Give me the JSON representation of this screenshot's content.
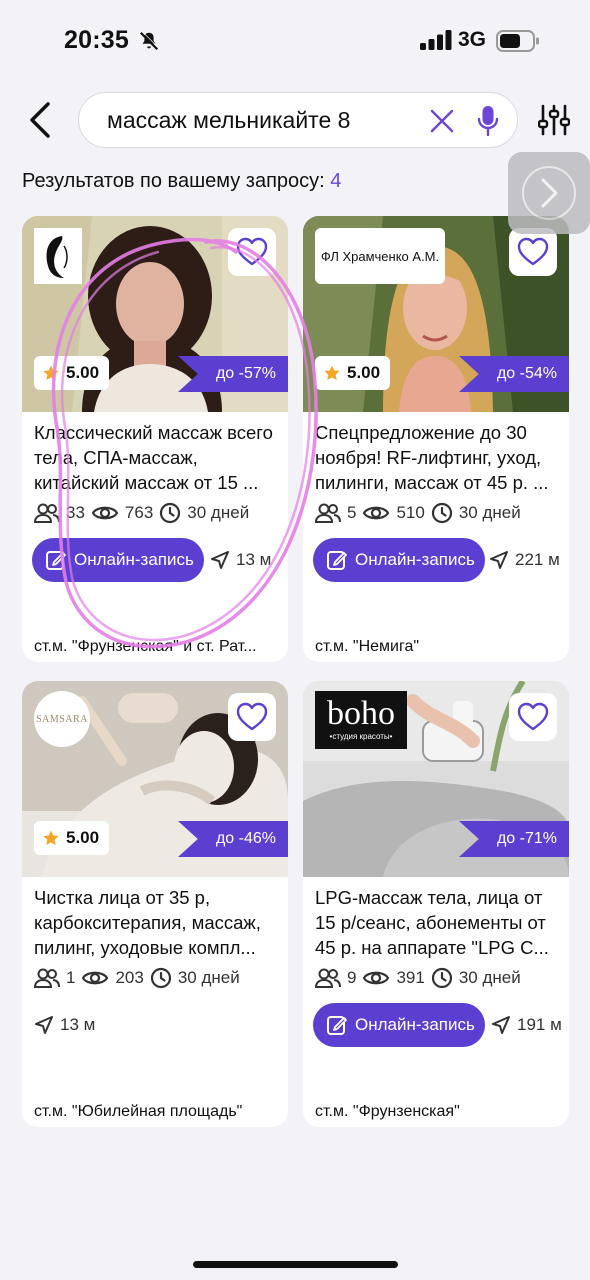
{
  "status_bar": {
    "time": "20:35",
    "network": "3G"
  },
  "search": {
    "query": "массаж мельникайте 8"
  },
  "results": {
    "label": "Результатов по вашему запросу:",
    "count": "4"
  },
  "cards": [
    {
      "logo_text": "",
      "rating": "5.00",
      "discount": "до -57%",
      "title": "Классический массаж всего тела, СПА-массаж, китайский массаж от 15 ...",
      "visitors": "33",
      "views": "763",
      "duration": "30 дней",
      "book_label": "Онлайн-запись",
      "distance": "13 м",
      "metro": "ст.м. \"Фрунзенская\" и ст. Рат..."
    },
    {
      "logo_text": "ФЛ Храмченко А.М.",
      "rating": "5.00",
      "discount": "до -54%",
      "title": "Спецпредложение до 30 ноября! RF-лифтинг, уход, пилинги, массаж от 45 р. ...",
      "visitors": "5",
      "views": "510",
      "duration": "30 дней",
      "book_label": "Онлайн-запись",
      "distance": "221 м",
      "metro": "ст.м. \"Немига\""
    },
    {
      "logo_text": "SAMSARA",
      "rating": "5.00",
      "discount": "до -46%",
      "title": "Чистка лица от 35 р, карбокситерапия, массаж, пилинг, уходовые компл...",
      "visitors": "1",
      "views": "203",
      "duration": "30 дней",
      "book_label": "",
      "distance": "13 м",
      "metro": "ст.м. \"Юбилейная площадь\""
    },
    {
      "logo_text": "boho",
      "logo_sub": "•студия красоты•",
      "rating": "",
      "discount": "до -71%",
      "title": "LPG-массаж тела, лица от 15 р/сеанс, абонементы от 45 р. на аппарате \"LPG C...",
      "visitors": "9",
      "views": "391",
      "duration": "30 дней",
      "book_label": "Онлайн-запись",
      "distance": "191 м",
      "metro": "ст.м. \"Фрунзенская\""
    }
  ],
  "colors": {
    "accent": "#5b3fd0",
    "background": "#f3f2f7",
    "star": "#f5a623",
    "annotation": "#e37ee6"
  }
}
